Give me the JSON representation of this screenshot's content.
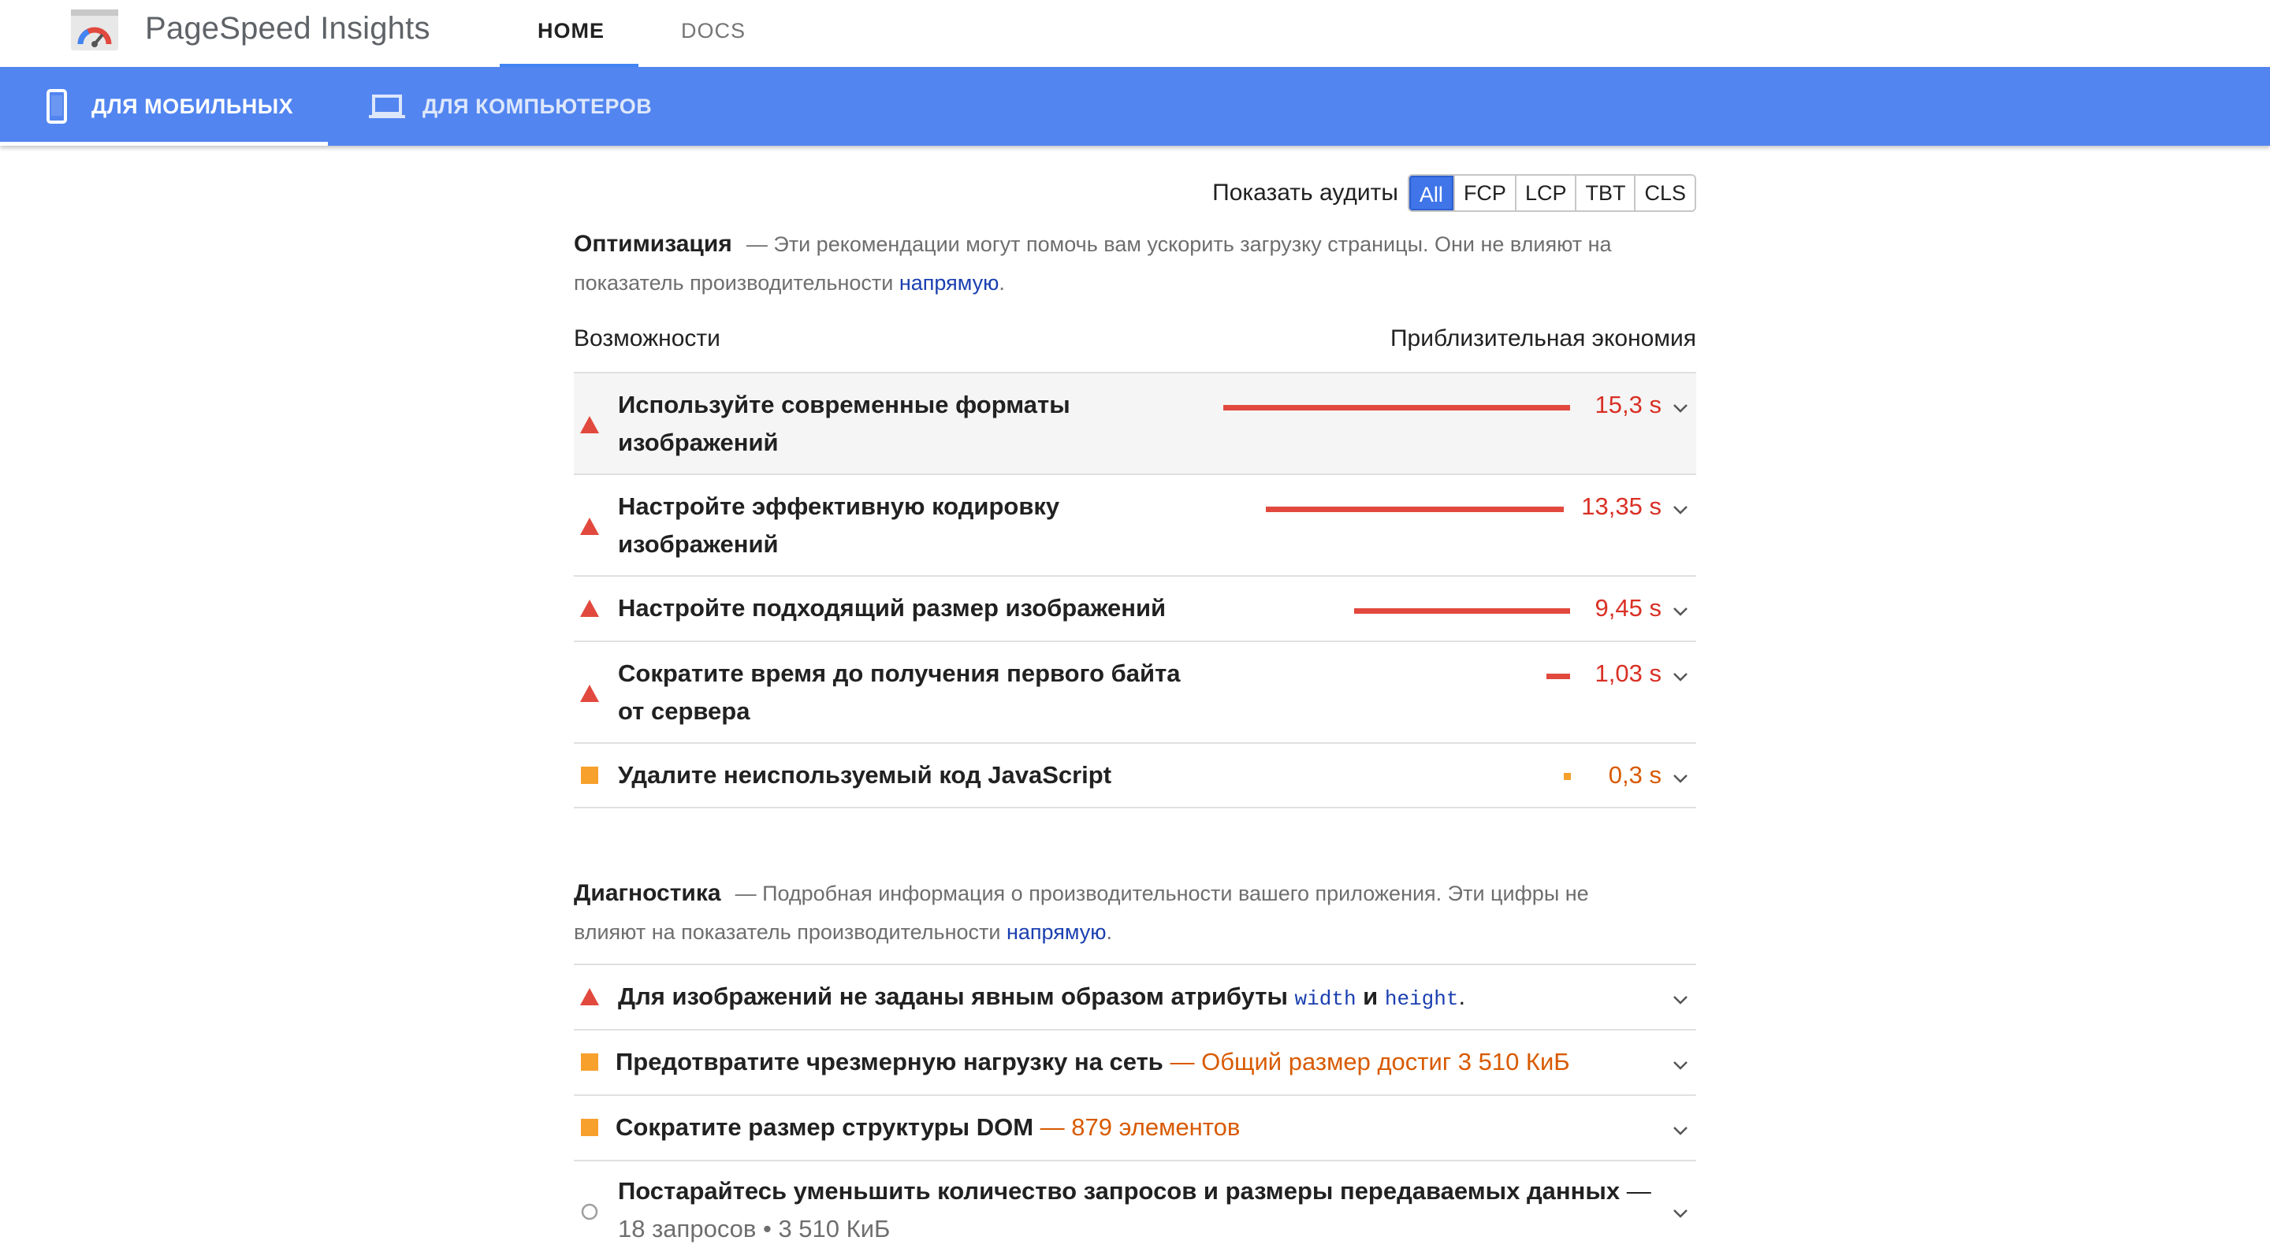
{
  "app": {
    "title": "PageSpeed Insights"
  },
  "nav": {
    "home": "HOME",
    "docs": "DOCS"
  },
  "mode_tabs": {
    "mobile": "ДЛЯ МОБИЛЬНЫХ",
    "desktop": "ДЛЯ КОМПЬЮТЕРОВ"
  },
  "filter": {
    "label": "Показать аудиты",
    "options": [
      "All",
      "FCP",
      "LCP",
      "TBT",
      "CLS"
    ],
    "selected": "All"
  },
  "optimization": {
    "title": "Оптимизация",
    "desc_line1": "— Эти рекомендации могут помочь вам ускорить загрузку страницы. Они не влияют на",
    "desc_line2": "показатель производительности ",
    "link": "напрямую",
    "period": ".",
    "col_left": "Возможности",
    "col_right": "Приблизительная экономия",
    "items": [
      {
        "line1": "Используйте современные форматы",
        "line2": "изображений",
        "value": "15,3 s",
        "savings_fraction": 1.0,
        "severity": "fail"
      },
      {
        "line1": "Настройте эффективную кодировку",
        "line2": "изображений",
        "value": "13,35 s",
        "savings_fraction": 0.87,
        "severity": "fail"
      },
      {
        "line1": "Настройте подходящий размер изображений",
        "line2": "",
        "value": "9,45 s",
        "savings_fraction": 0.62,
        "severity": "fail"
      },
      {
        "line1": "Сократите время до получения первого байта",
        "line2": "от сервера",
        "value": "1,03 s",
        "savings_fraction": 0.07,
        "severity": "fail"
      },
      {
        "line1": "Удалите неиспользуемый код JavaScript",
        "line2": "",
        "value": "0,3 s",
        "savings_fraction": 0.02,
        "severity": "average"
      }
    ]
  },
  "diagnostics": {
    "title": "Диагностика",
    "desc_line1": "— Подробная информация о производительности вашего приложения. Эти цифры не",
    "desc_line2": "влияют на показатель производительности ",
    "link": "напрямую",
    "period": ".",
    "items": [
      {
        "text": "Для изображений не заданы явным образом атрибуты ",
        "code1": "width",
        "and": " и ",
        "code2": "height",
        "end": ".",
        "severity": "fail"
      },
      {
        "text": "Предотвратите чрезмерную нагрузку на сеть",
        "detail": " — Общий размер достиг 3 510 КиБ",
        "severity": "average"
      },
      {
        "text": "Сократите размер структуры DOM",
        "detail": " — 879 элементов",
        "severity": "average"
      },
      {
        "text": "Постарайтесь уменьшить количество запросов и размеры передаваемых данных",
        "dash": " —",
        "line2": "18 запросов • 3 510 КиБ",
        "severity": "info"
      }
    ]
  },
  "colors": {
    "accent": "#5285f0",
    "fail": "#e2493e",
    "average": "#f7a02c",
    "link": "#1a3fb0"
  },
  "icons": {
    "logo": "pagespeed-logo",
    "mobile": "phone-icon",
    "desktop": "laptop-icon",
    "fail": "red-triangle-icon",
    "average": "orange-square-icon",
    "info": "gray-circle-icon",
    "expand": "chevron-down-icon"
  }
}
